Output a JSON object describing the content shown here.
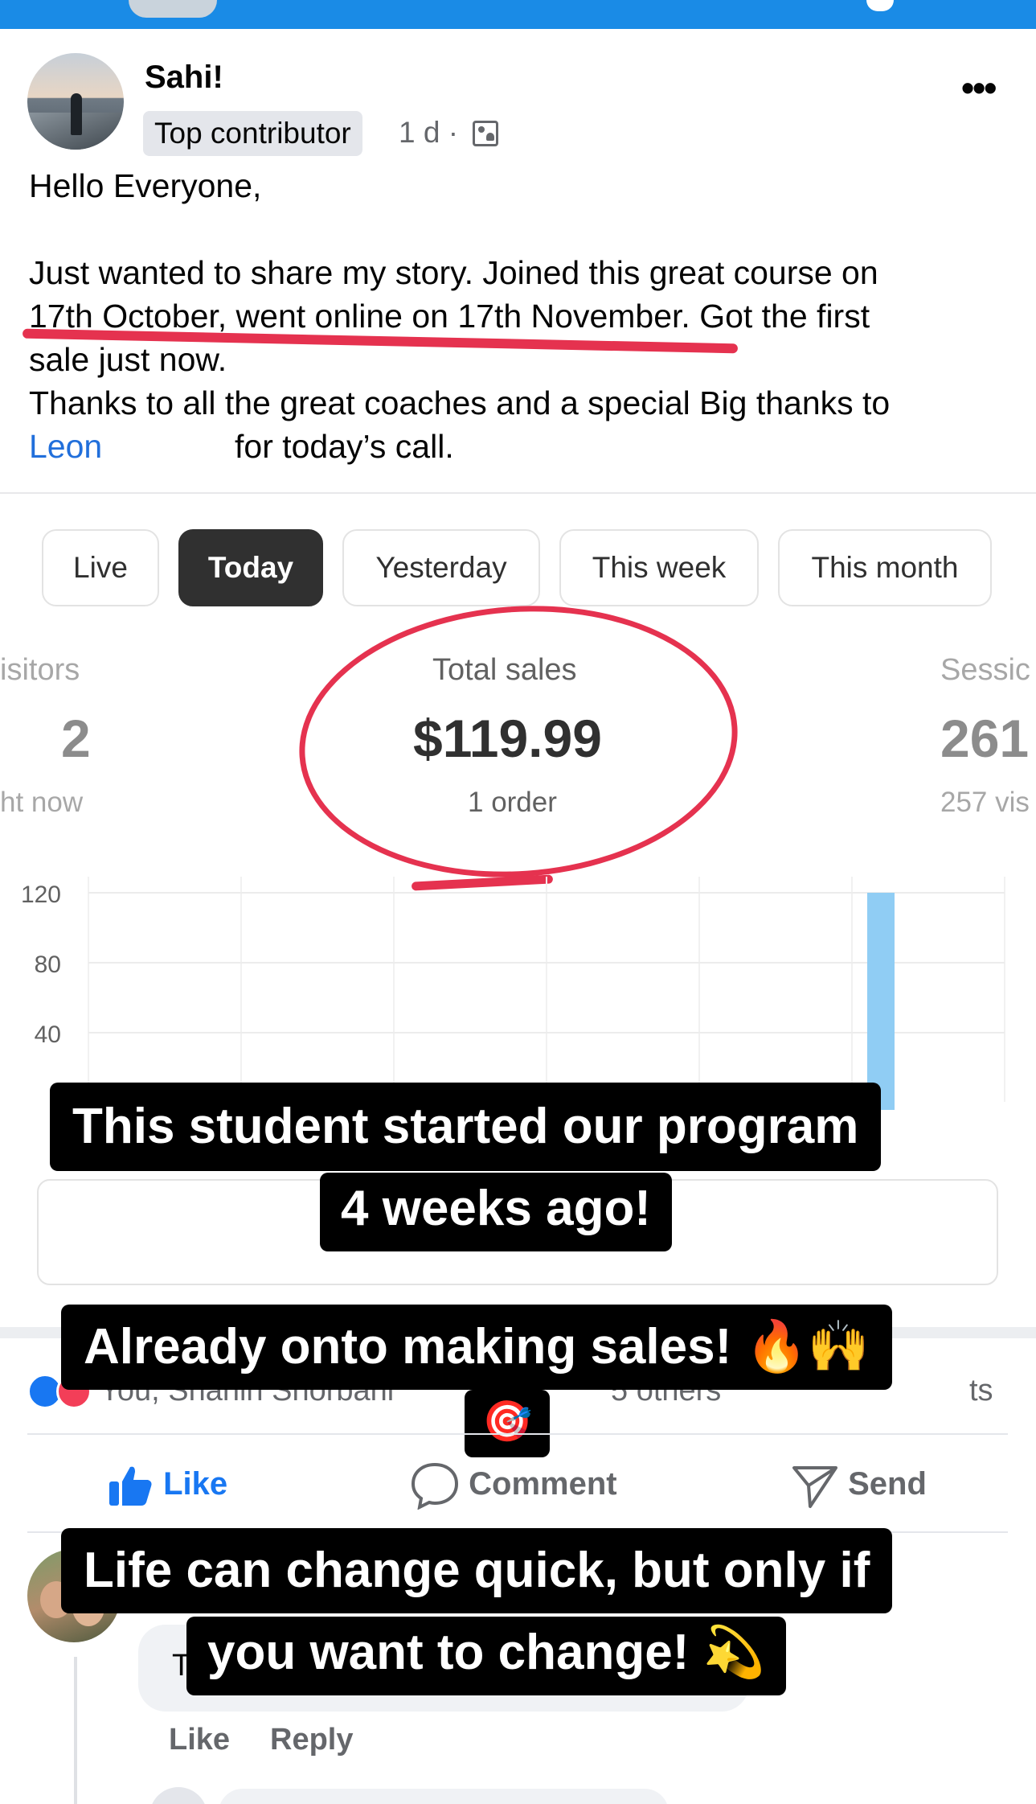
{
  "post": {
    "author": "Sahi!",
    "badge": "Top contributor",
    "time": "1 d ·",
    "more": "•••",
    "greeting": "Hello Everyone,",
    "line1": "Just wanted to share my story. Joined this great course on",
    "line2": "17th October, went online on 17th November. Got the first",
    "line3": "sale just now.",
    "line4": "Thanks to all the great coaches and a special Big thanks to",
    "mention": "Leon",
    "line5": "for today’s call."
  },
  "dashboard": {
    "tabs": [
      "Live",
      "Today",
      "Yesterday",
      "This week",
      "This month"
    ],
    "active_tab": "Today",
    "metrics": {
      "visitors": {
        "label": "isitors",
        "value": "2",
        "sub": "ht now"
      },
      "sales": {
        "label": "Total sales",
        "value": "$119.99",
        "sub": "1 order"
      },
      "sessions": {
        "label": "Sessic",
        "value": "261",
        "sub": "257 vis"
      }
    },
    "accent": "#e5324f"
  },
  "chart_data": {
    "type": "bar",
    "yticks": [
      "120",
      "80",
      "40"
    ],
    "ylim": [
      0,
      120
    ],
    "bars": [
      {
        "x_fraction": 0.85,
        "value": 120
      }
    ],
    "bar_color": "#90cdf4"
  },
  "captions": {
    "c1_line1": "This student started our program",
    "c1_line2": "4 weeks ago!",
    "c2_line1": "Already onto making sales! 🔥🙌",
    "c2_line2": "🎯",
    "c3_line1": "Life can change quick, but only if",
    "c3_line2": "you want to change! 💫"
  },
  "reactions": {
    "names_fragment": "You, Shahin Shorbani",
    "others_fragment": "5 others",
    "comments_fragment": "ts"
  },
  "actions": {
    "like": "Like",
    "comment": "Comment",
    "send": "Send"
  },
  "comment": {
    "bubble_letter": "T",
    "like": "Like",
    "reply": "Reply"
  }
}
